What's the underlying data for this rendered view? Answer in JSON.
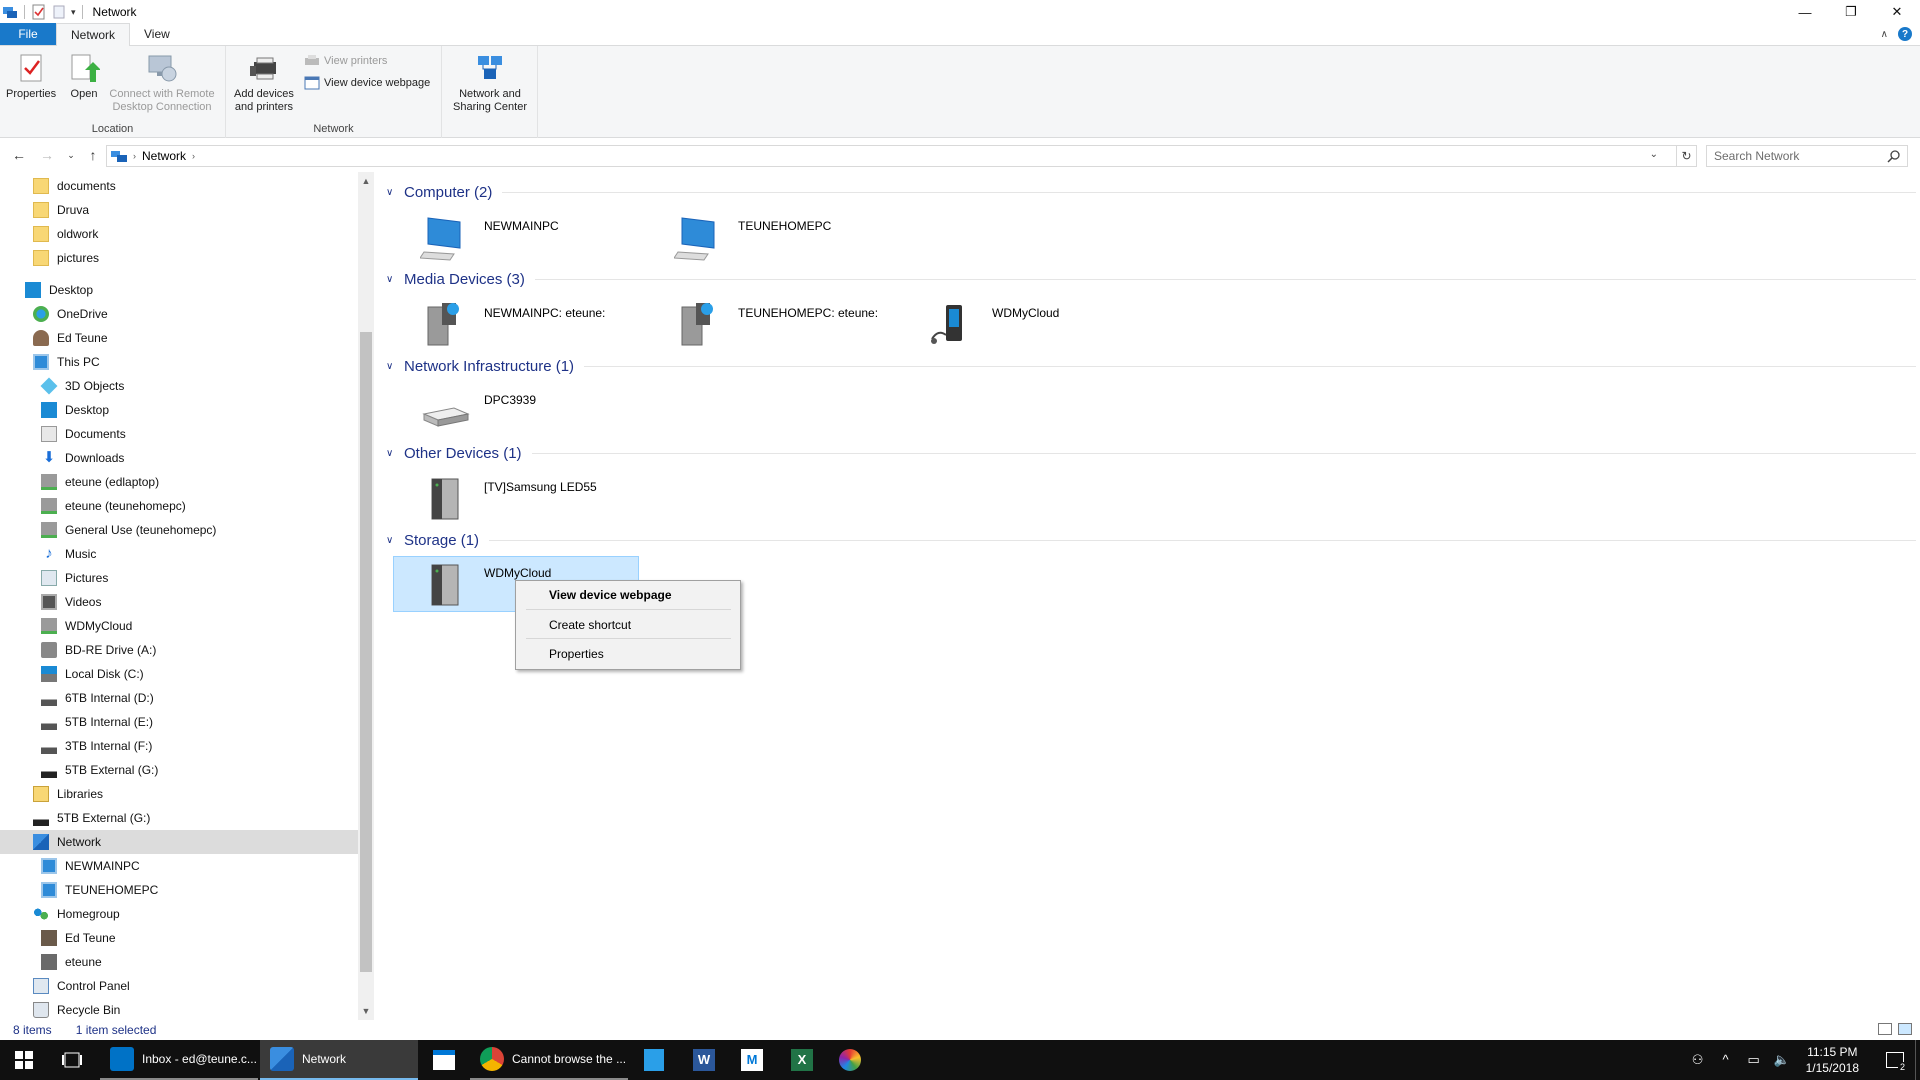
{
  "window": {
    "title": "Network",
    "minimize": "—",
    "restore": "❐",
    "close": "✕"
  },
  "ribbon": {
    "tabs": [
      {
        "label": "File"
      },
      {
        "label": "Network"
      },
      {
        "label": "View"
      }
    ],
    "location_group": {
      "label": "Location",
      "properties": "Properties",
      "open": "Open",
      "connect_line1": "Connect with Remote",
      "connect_line2": "Desktop Connection"
    },
    "network_group": {
      "label": "Network",
      "add_line1": "Add devices",
      "add_line2": "and printers",
      "view_printers": "View printers",
      "view_device_webpage": "View device webpage"
    },
    "sharing": {
      "line1": "Network and",
      "line2": "Sharing Center"
    },
    "help": "?"
  },
  "address": {
    "crumbs": [
      "Network"
    ],
    "search_placeholder": "Search Network"
  },
  "nav": {
    "items": [
      {
        "label": "documents",
        "icon": "folder-icon"
      },
      {
        "label": "Druva",
        "icon": "folder-icon"
      },
      {
        "label": "oldwork",
        "icon": "folder-icon"
      },
      {
        "label": "pictures",
        "icon": "folder-icon"
      },
      {
        "label": "Desktop",
        "icon": "desktop-icon"
      },
      {
        "label": "OneDrive",
        "icon": "onedrive-icon"
      },
      {
        "label": "Ed Teune",
        "icon": "user-icon"
      },
      {
        "label": "This PC",
        "icon": "pc-icon"
      },
      {
        "label": "3D Objects",
        "icon": "3d-objects-icon"
      },
      {
        "label": "Desktop",
        "icon": "desktop-icon"
      },
      {
        "label": "Documents",
        "icon": "documents-icon"
      },
      {
        "label": "Downloads",
        "icon": "downloads-icon"
      },
      {
        "label": "eteune (edlaptop)",
        "icon": "network-drive-icon"
      },
      {
        "label": "eteune (teunehomepc)",
        "icon": "network-drive-icon"
      },
      {
        "label": "General Use (teunehomepc)",
        "icon": "network-drive-icon"
      },
      {
        "label": "Music",
        "icon": "music-icon"
      },
      {
        "label": "Pictures",
        "icon": "pictures-icon"
      },
      {
        "label": "Videos",
        "icon": "videos-icon"
      },
      {
        "label": "WDMyCloud",
        "icon": "network-drive-icon"
      },
      {
        "label": "BD-RE Drive (A:)",
        "icon": "optical-drive-icon"
      },
      {
        "label": "Local Disk (C:)",
        "icon": "local-disk-icon"
      },
      {
        "label": "6TB Internal (D:)",
        "icon": "disk-icon"
      },
      {
        "label": "5TB Internal (E:)",
        "icon": "disk-icon"
      },
      {
        "label": "3TB Internal (F:)",
        "icon": "disk-icon"
      },
      {
        "label": "5TB External (G:)",
        "icon": "disk-icon"
      },
      {
        "label": "Libraries",
        "icon": "libraries-icon"
      },
      {
        "label": "5TB External (G:)",
        "icon": "disk-icon"
      },
      {
        "label": "Network",
        "icon": "network-icon"
      },
      {
        "label": "NEWMAINPC",
        "icon": "computer-icon"
      },
      {
        "label": "TEUNEHOMEPC",
        "icon": "computer-icon"
      },
      {
        "label": "Homegroup",
        "icon": "homegroup-icon"
      },
      {
        "label": "Ed Teune",
        "icon": "user-icon"
      },
      {
        "label": "eteune",
        "icon": "user-icon"
      },
      {
        "label": "Control Panel",
        "icon": "control-panel-icon"
      },
      {
        "label": "Recycle Bin",
        "icon": "recycle-bin-icon"
      }
    ]
  },
  "content": {
    "groups": [
      {
        "title": "Computer (2)",
        "items": [
          "NEWMAINPC",
          "TEUNEHOMEPC"
        ]
      },
      {
        "title": "Media Devices (3)",
        "items": [
          "NEWMAINPC: eteune:",
          "TEUNEHOMEPC: eteune:",
          "WDMyCloud"
        ]
      },
      {
        "title": "Network Infrastructure (1)",
        "items": [
          "DPC3939"
        ]
      },
      {
        "title": "Other Devices (1)",
        "items": [
          "[TV]Samsung LED55"
        ]
      },
      {
        "title": "Storage (1)",
        "items": [
          "WDMyCloud"
        ]
      }
    ]
  },
  "context_menu": {
    "items": [
      "View device webpage",
      "Create shortcut",
      "Properties"
    ]
  },
  "status": {
    "count": "8 items",
    "selection": "1 item selected"
  },
  "taskbar": {
    "apps": [
      {
        "label": "Inbox - ed@teune.c..."
      },
      {
        "label": "Network"
      },
      {
        "label": "Cannot browse the ..."
      }
    ],
    "time": "11:15 PM",
    "date": "1/15/2018",
    "notifications": "2"
  },
  "colors": {
    "accent": "#1979ca",
    "group_title": "#1e3287",
    "selection": "#cce8ff",
    "taskbar": "#101010"
  }
}
